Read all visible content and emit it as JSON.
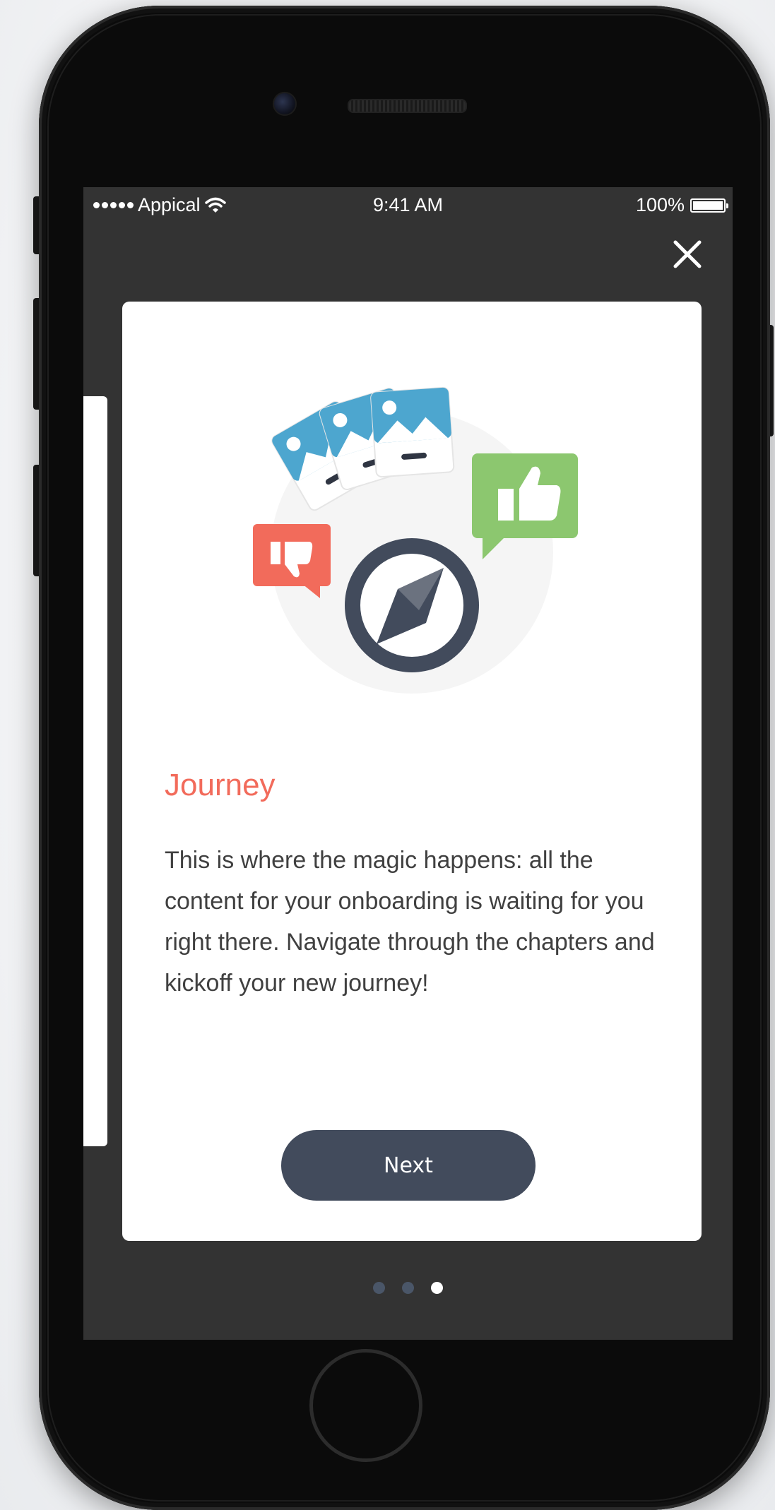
{
  "status_bar": {
    "carrier": "Appical",
    "time": "9:41 AM",
    "battery": "100%"
  },
  "close": {
    "icon": "close-icon"
  },
  "card": {
    "title": "Journey",
    "body": "This is where the magic happens: all the content for your onboarding is waiting for you right there. Navigate through the chapters and kickoff your new journey!",
    "next_label": "Next"
  },
  "pager": {
    "total": 3,
    "active_index": 2
  },
  "colors": {
    "title": "#f26b5b",
    "button": "#424b5c",
    "screen_bg": "#333333",
    "thumbs_up": "#8cc76f",
    "thumbs_down": "#f26b5b",
    "photo_card": "#4da6cf",
    "compass": "#424b5c"
  }
}
